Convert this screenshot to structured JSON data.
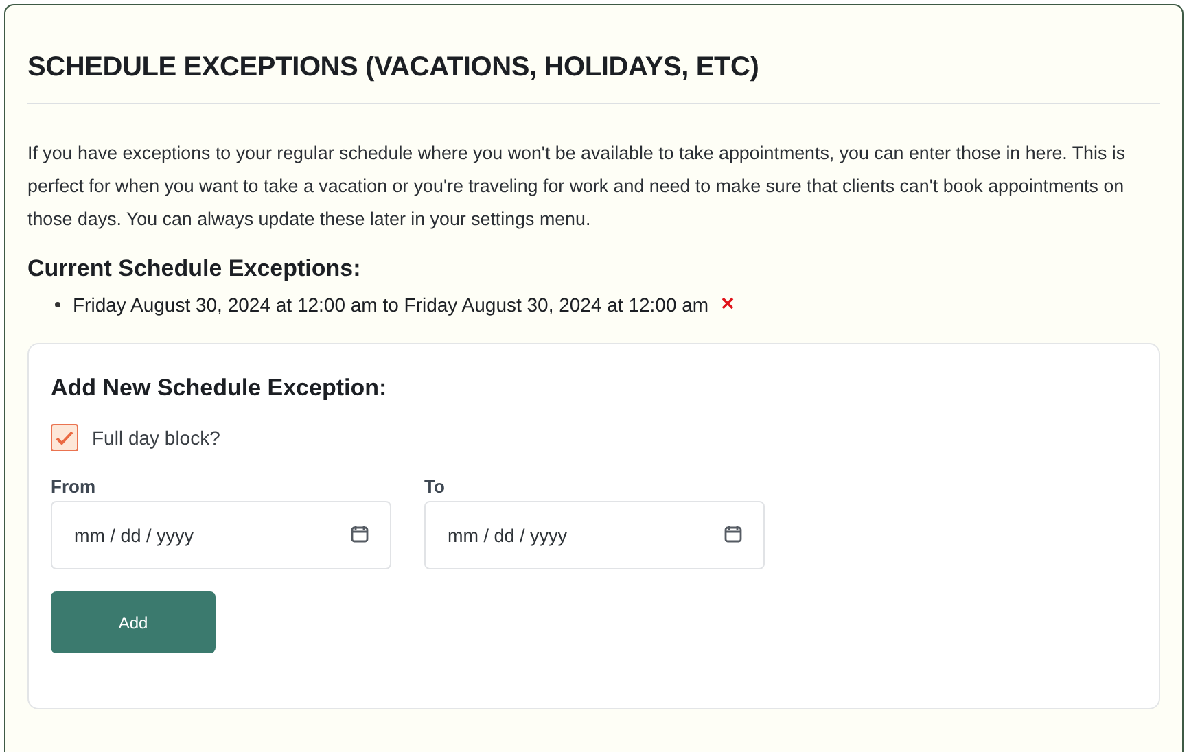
{
  "title": "SCHEDULE EXCEPTIONS (VACATIONS, HOLIDAYS, ETC)",
  "description": "If you have exceptions to your regular schedule where you won't be available to take appointments, you can enter those in here. This is perfect for when you want to take a vacation or you're traveling for work and need to make sure that clients can't book appointments on those days. You can always update these later in your settings menu.",
  "current": {
    "heading": "Current Schedule Exceptions:",
    "items": [
      {
        "text": "Friday August 30, 2024 at 12:00 am to Friday August 30, 2024 at 12:00 am"
      }
    ]
  },
  "form": {
    "heading": "Add New Schedule Exception:",
    "full_day": {
      "label": "Full day block?",
      "checked": true
    },
    "fields": [
      {
        "label": "From",
        "placeholder": "mm / dd / yyyy"
      },
      {
        "label": "To",
        "placeholder": "mm / dd / yyyy"
      }
    ],
    "button": "Add"
  }
}
